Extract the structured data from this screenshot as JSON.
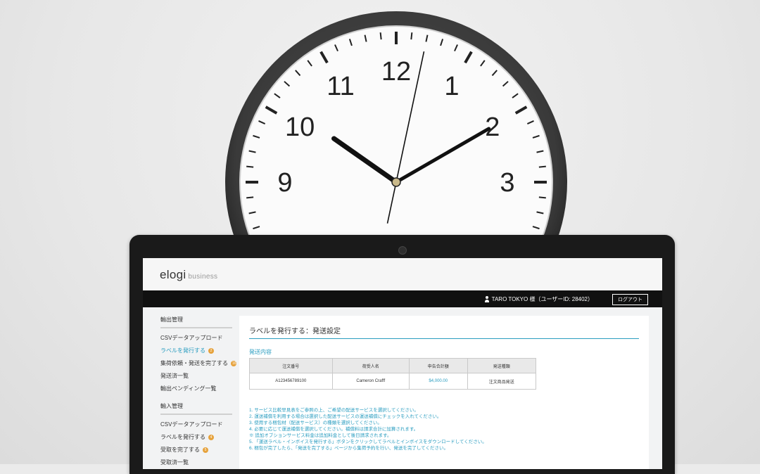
{
  "clock": {
    "numerals": [
      "12",
      "1",
      "2",
      "3",
      "9",
      "10",
      "11"
    ],
    "time": {
      "hour": 10,
      "minute": 10,
      "second": 2
    }
  },
  "app": {
    "logo_main": "elogi",
    "logo_sub": "business",
    "user_label": "TARO TOKYO 様（ユーザーID: 28402）",
    "logout_label": "ログアウト"
  },
  "sidebar": {
    "sections": [
      {
        "title": "輸出管理",
        "items": [
          {
            "label": "CSVデータアップロード",
            "badge": null,
            "active": false
          },
          {
            "label": "ラベルを発行する",
            "badge": "2",
            "active": true
          },
          {
            "label": "集荷依頼・発送を完了する",
            "badge": "16",
            "active": false
          },
          {
            "label": "発送済一覧",
            "badge": null,
            "active": false
          },
          {
            "label": "輸出ペンディング一覧",
            "badge": null,
            "active": false
          }
        ]
      },
      {
        "title": "輸入管理",
        "items": [
          {
            "label": "CSVデータアップロード",
            "badge": null,
            "active": false
          },
          {
            "label": "ラベルを発行する",
            "badge": "4",
            "active": false
          },
          {
            "label": "受取を完了する",
            "badge": "5",
            "active": false
          },
          {
            "label": "受取済一覧",
            "badge": null,
            "active": false
          }
        ]
      }
    ]
  },
  "main": {
    "title": "ラベルを発行する：発送設定",
    "section_heading": "発送内容",
    "table": {
      "headers": [
        "注文番号",
        "荷受人名",
        "申告合計額",
        "発送種類"
      ],
      "rows": [
        [
          "A123456789100",
          "Cameron Crafff",
          "$4,000.00",
          "注文商品発送"
        ]
      ]
    },
    "notes": [
      "1. サービス比較早見表をご参照の上、ご希望の配送サービスを選択してください。",
      "2. 運送補償を利用する場合は選択した配送サービスの運送補償にチェックを入れてください。",
      "3. 使用する梱包材（配送サービス）の種類を選択してください。",
      "4. 必要に応じて運送補償を選択してください。補償料は請求合計に加算されます。",
      "※ 追加オプションサービス料金は追加料金として後日請求されます。",
      "5. 「運送ラベル・インボイスを発行する」ボタンをクリックしてラベルとインボイスをダウンロードしてください。",
      "6. 梱包が完了したら、「発送を完了する」ページから集荷予約を行い、発送を完了してください。"
    ]
  },
  "colors": {
    "accent": "#2a9dc0",
    "badge": "#e6a23c",
    "bezel": "#1a1a1a",
    "clock_frame": "#3a3a3a"
  }
}
